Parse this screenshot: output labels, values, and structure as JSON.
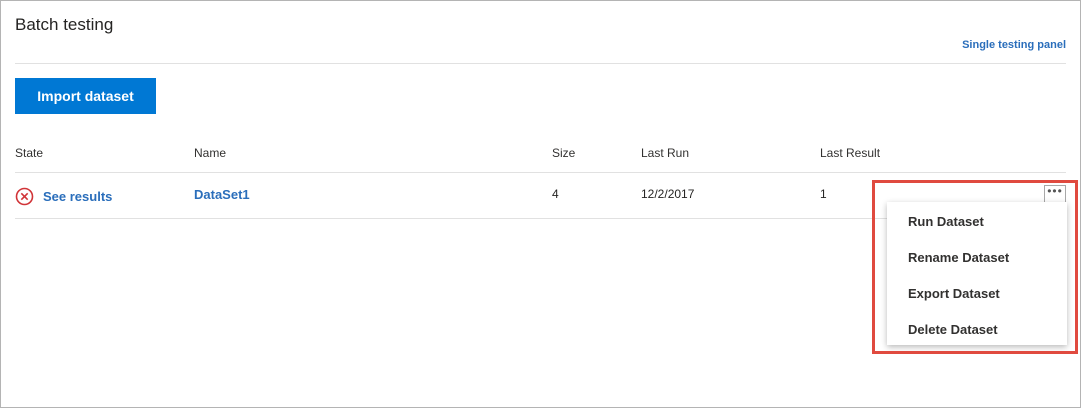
{
  "header": {
    "title": "Batch testing",
    "single_testing_panel": "Single testing panel"
  },
  "toolbar": {
    "import_label": "Import dataset"
  },
  "table": {
    "columns": [
      "State",
      "Name",
      "Size",
      "Last Run",
      "Last Result"
    ],
    "rows": [
      {
        "state_icon": "error-circle-icon",
        "state_label": "See results",
        "name": "DataSet1",
        "size": "4",
        "last_run": "12/2/2017",
        "last_result": "1"
      }
    ]
  },
  "context_menu": {
    "items": [
      "Run Dataset",
      "Rename Dataset",
      "Export Dataset",
      "Delete Dataset"
    ]
  },
  "colors": {
    "accent": "#0078d4",
    "link": "#2a6ebb",
    "error": "#d13438",
    "highlight": "#e04a3f"
  }
}
